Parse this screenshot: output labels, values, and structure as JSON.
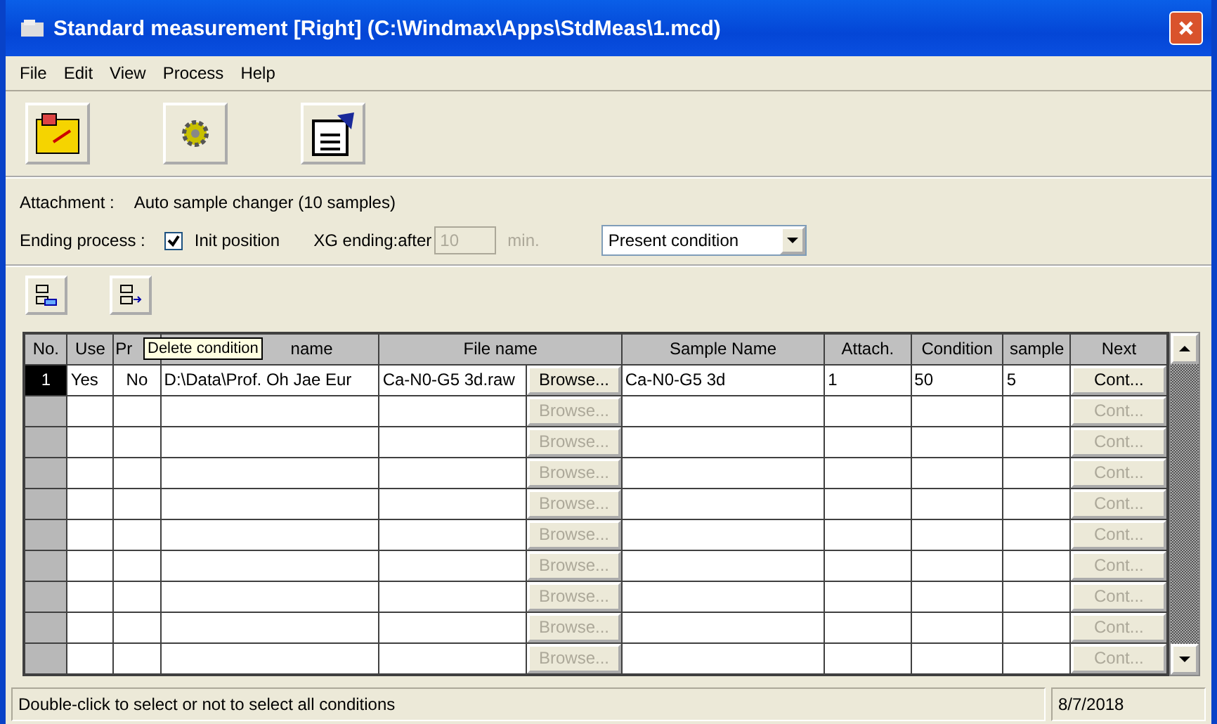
{
  "window": {
    "title": "Standard measurement [Right] (C:\\Windmax\\Apps\\StdMeas\\1.mcd)"
  },
  "menu": [
    "File",
    "Edit",
    "View",
    "Process",
    "Help"
  ],
  "settings": {
    "attachment_label": "Attachment :",
    "attachment_value": "Auto sample changer (10 samples)",
    "ending_label": "Ending process :",
    "init_position": {
      "label": "Init position",
      "checked": true
    },
    "xg_label": "XG ending:after",
    "xg_value": "10",
    "xg_disabled": true,
    "xg_unit": "min.",
    "condition_select": "Present condition"
  },
  "tooltip": "Delete condition",
  "table": {
    "columns": [
      "No.",
      "Use",
      "Pr",
      "name",
      "File name",
      "Sample Name",
      "Attach.",
      "Condition",
      "sample",
      "Next"
    ],
    "rows": [
      {
        "no": "1",
        "selected": true,
        "use": "Yes",
        "pr": "No",
        "name": "D:\\Data\\Prof. Oh Jae Eur",
        "file": "Ca-N0-G5 3d.raw",
        "browse": {
          "label": "Browse...",
          "disabled": false
        },
        "sample_name": "Ca-N0-G5 3d",
        "attach": "1",
        "condition": "50",
        "sample": "5",
        "next": {
          "label": "Cont...",
          "disabled": false
        }
      },
      {
        "selected": false,
        "browse": {
          "label": "Browse...",
          "disabled": true
        },
        "next": {
          "label": "Cont...",
          "disabled": true
        }
      },
      {
        "selected": false,
        "browse": {
          "label": "Browse...",
          "disabled": true
        },
        "next": {
          "label": "Cont...",
          "disabled": true
        }
      },
      {
        "selected": false,
        "browse": {
          "label": "Browse...",
          "disabled": true
        },
        "next": {
          "label": "Cont...",
          "disabled": true
        }
      },
      {
        "selected": false,
        "browse": {
          "label": "Browse...",
          "disabled": true
        },
        "next": {
          "label": "Cont...",
          "disabled": true
        }
      },
      {
        "selected": false,
        "browse": {
          "label": "Browse...",
          "disabled": true
        },
        "next": {
          "label": "Cont...",
          "disabled": true
        }
      },
      {
        "selected": false,
        "browse": {
          "label": "Browse...",
          "disabled": true
        },
        "next": {
          "label": "Cont...",
          "disabled": true
        }
      },
      {
        "selected": false,
        "browse": {
          "label": "Browse...",
          "disabled": true
        },
        "next": {
          "label": "Cont...",
          "disabled": true
        }
      },
      {
        "selected": false,
        "browse": {
          "label": "Browse...",
          "disabled": true
        },
        "next": {
          "label": "Cont...",
          "disabled": true
        }
      },
      {
        "selected": false,
        "browse": {
          "label": "Browse...",
          "disabled": true
        },
        "next": {
          "label": "Cont...",
          "disabled": true
        }
      }
    ]
  },
  "status_bar": {
    "message": "Double-click to select or not to select all conditions",
    "date": "8/7/2018"
  }
}
